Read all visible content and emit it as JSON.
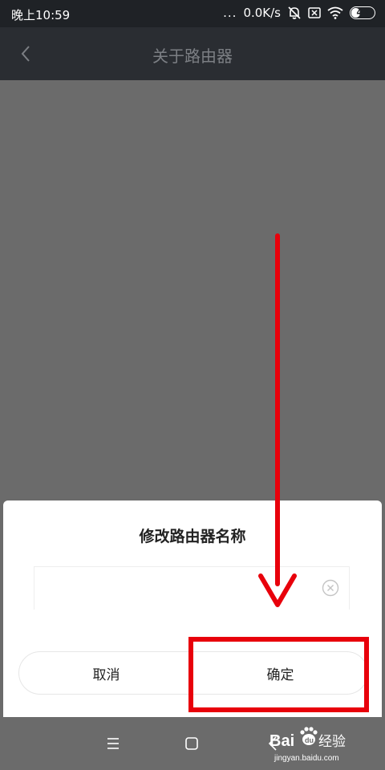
{
  "status_bar": {
    "time": "晚上10:59",
    "dots": "...",
    "speed": "0.0K/s",
    "battery_level": "42"
  },
  "header": {
    "title": "关于路由器"
  },
  "dialog": {
    "title": "修改路由器名称",
    "input_value": "",
    "cancel_label": "取消",
    "confirm_label": "确定"
  },
  "watermark": {
    "brand_text": "Bai",
    "brand_suffix": "经验",
    "url": "jingyan.baidu.com"
  },
  "colors": {
    "annotation_red": "#e8000b",
    "overlay": "#6b6b6b",
    "status_bar_bg": "#1f2226"
  },
  "icons": {
    "back": "chevron-left-icon",
    "clear": "circle-x-icon",
    "mute": "bell-off-icon",
    "sim": "sim-x-icon",
    "wifi": "wifi-icon",
    "nav_menu": "menu-icon",
    "nav_home": "square-icon",
    "nav_back": "chevron-left-icon"
  }
}
